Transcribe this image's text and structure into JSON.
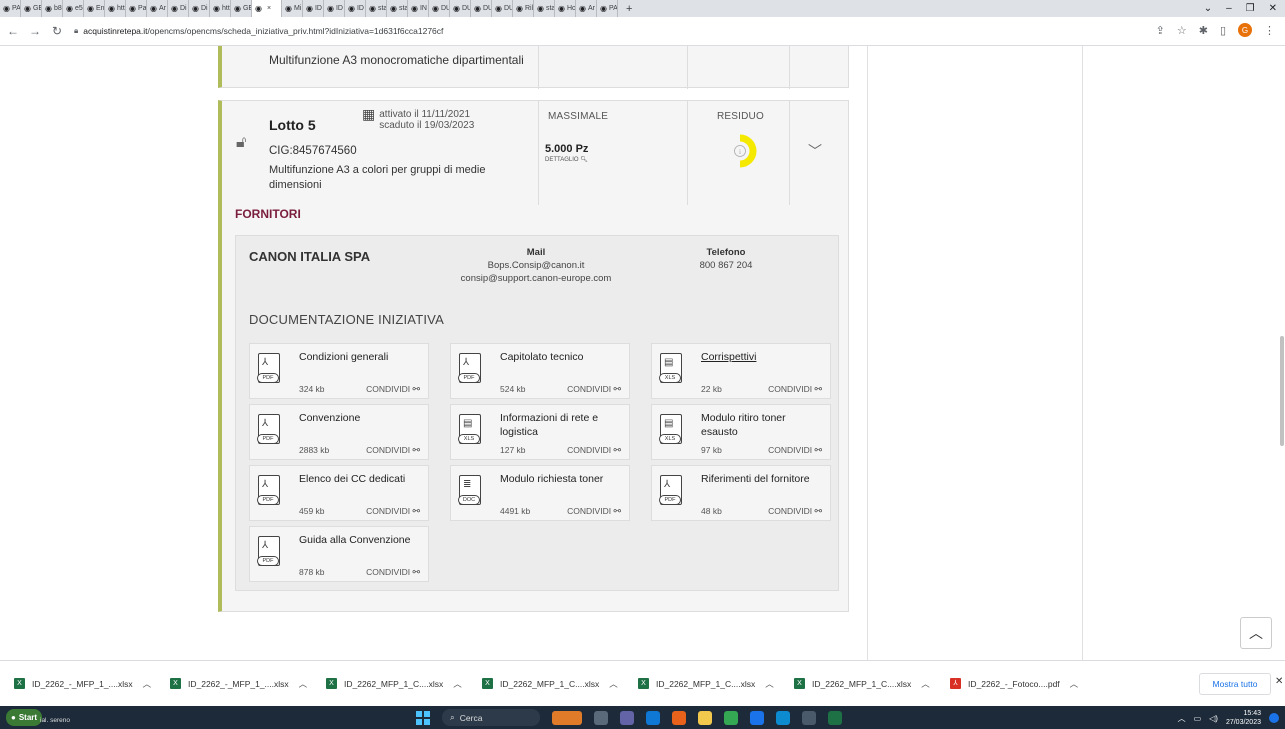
{
  "browser": {
    "tabs": [
      "PA",
      "GE",
      "b8",
      "e5",
      "En",
      "htt",
      "Pa",
      "Ar",
      "Di",
      "Di",
      "htt",
      "GE",
      "",
      "Mi",
      "ID",
      "ID",
      "ID",
      "sta",
      "sta",
      "IN",
      "DU",
      "DU",
      "DU",
      "DU",
      "Ril",
      "sta",
      "Ho",
      "Ar",
      "PA"
    ],
    "active_tab_index": 12,
    "new_tab": "+",
    "tab_close": "×",
    "url_host": "acquistinretepa.it",
    "url_path": "/opencms/opencms/scheda_iniziativa_priv.html?idIniziativa=1d631f6cca1276cf",
    "profile_initial": "G"
  },
  "prev_lot": {
    "description": "Multifunzione A3 monocromatiche dipartimentali"
  },
  "lot": {
    "title": "Lotto 5",
    "activated": "attivato il 11/11/2021",
    "expired": "scaduto il 19/03/2023",
    "cig": "CIG:8457674560",
    "description": "Multifunzione A3 a colori per gruppi di medie dimensioni",
    "massimale_label": "MASSIMALE",
    "massimale_value": "5.000 Pz",
    "dettaglio_label": "DETTAGLIO",
    "residuo_label": "RESIDUO",
    "residuo_fraction": 0.5,
    "gauge_color": "#f5e900"
  },
  "fornitori": {
    "heading": "FORNITORI",
    "supplier_name": "CANON ITALIA SPA",
    "mail_label": "Mail",
    "mail_1": "Bops.Consip@canon.it",
    "mail_2": "consip@support.canon-europe.com",
    "phone_label": "Telefono",
    "phone": "800 867 204"
  },
  "docs": {
    "heading": "DOCUMENTAZIONE INIZIATIVA",
    "share_label": "CONDIVIDI",
    "items": [
      {
        "name": "Condizioni generali",
        "size": "324 kb",
        "type": "PDF",
        "link": false
      },
      {
        "name": "Capitolato tecnico",
        "size": "524 kb",
        "type": "PDF",
        "link": false
      },
      {
        "name": "Corrispettivi",
        "size": "22 kb",
        "type": "XLS",
        "link": true
      },
      {
        "name": "Convenzione",
        "size": "2883 kb",
        "type": "PDF",
        "link": false
      },
      {
        "name": "Informazioni di rete e logistica",
        "size": "127 kb",
        "type": "XLS",
        "link": false
      },
      {
        "name": "Modulo ritiro toner esausto",
        "size": "97 kb",
        "type": "XLS",
        "link": false
      },
      {
        "name": "Elenco dei CC dedicati",
        "size": "459 kb",
        "type": "PDF",
        "link": false
      },
      {
        "name": "Modulo richiesta toner",
        "size": "4491 kb",
        "type": "DOC",
        "link": false
      },
      {
        "name": "Riferimenti del fornitore",
        "size": "48 kb",
        "type": "PDF",
        "link": false
      },
      {
        "name": "Guida alla Convenzione",
        "size": "878 kb",
        "type": "PDF",
        "link": false
      }
    ]
  },
  "downloads": {
    "items": [
      {
        "name": "ID_2262_-_MFP_1_....xlsx",
        "type": "xlsx"
      },
      {
        "name": "ID_2262_-_MFP_1_....xlsx",
        "type": "xlsx"
      },
      {
        "name": "ID_2262_MFP_1_C....xlsx",
        "type": "xlsx"
      },
      {
        "name": "ID_2262_MFP_1_C....xlsx",
        "type": "xlsx"
      },
      {
        "name": "ID_2262_MFP_1_C....xlsx",
        "type": "xlsx"
      },
      {
        "name": "ID_2262_MFP_1_C....xlsx",
        "type": "xlsx"
      },
      {
        "name": "ID_2262_-_Fotoco....pdf",
        "type": "pdf"
      }
    ],
    "show_all": "Mostra tutto"
  },
  "taskbar": {
    "start_label": "Start",
    "user": "ial. sereno",
    "search_placeholder": "Cerca",
    "time": "15:43",
    "date": "27/03/2023"
  }
}
